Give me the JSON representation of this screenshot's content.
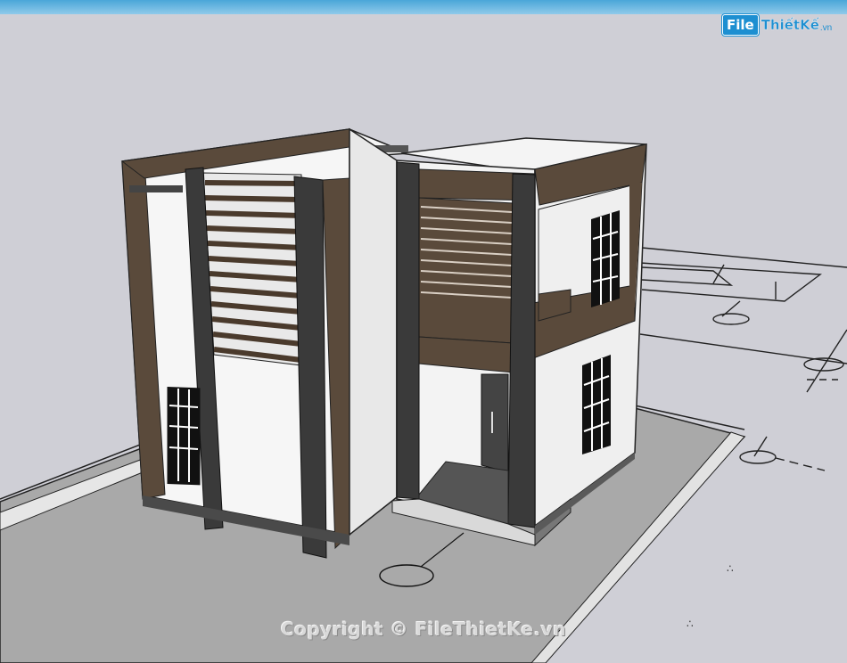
{
  "watermark": {
    "logo_file": "File",
    "logo_rest": "ThiếtKế",
    "logo_vn": ".vn",
    "copyright": "Copyright © FileThietKe.vn"
  }
}
